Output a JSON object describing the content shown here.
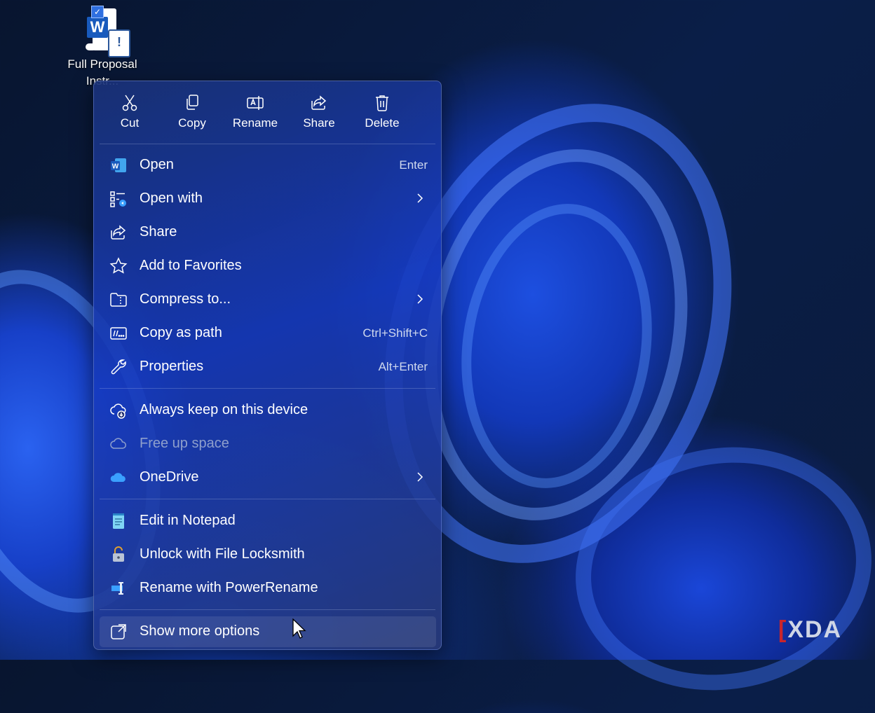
{
  "desktop": {
    "file_label_line1": "Full Proposal",
    "file_label_line2": "Instr...",
    "file_icon": "word-document-icon"
  },
  "toolbar": [
    {
      "label": "Cut",
      "icon": "scissors-icon"
    },
    {
      "label": "Copy",
      "icon": "copy-icon"
    },
    {
      "label": "Rename",
      "icon": "rename-icon"
    },
    {
      "label": "Share",
      "icon": "share-icon"
    },
    {
      "label": "Delete",
      "icon": "trash-icon"
    }
  ],
  "menu": {
    "items": [
      {
        "label": "Open",
        "shortcut": "Enter",
        "icon": "word-icon"
      },
      {
        "label": "Open with",
        "submenu": true,
        "icon": "open-with-icon"
      },
      {
        "label": "Share",
        "icon": "share-icon"
      },
      {
        "label": "Add to Favorites",
        "icon": "star-icon"
      },
      {
        "label": "Compress to...",
        "submenu": true,
        "icon": "zip-folder-icon"
      },
      {
        "label": "Copy as path",
        "shortcut": "Ctrl+Shift+C",
        "icon": "path-icon"
      },
      {
        "label": "Properties",
        "shortcut": "Alt+Enter",
        "icon": "wrench-icon"
      },
      {
        "label": "Always keep on this device",
        "icon": "cloud-download-icon"
      },
      {
        "label": "Free up space",
        "disabled": true,
        "icon": "cloud-icon"
      },
      {
        "label": "OneDrive",
        "submenu": true,
        "icon": "onedrive-icon"
      },
      {
        "label": "Edit in Notepad",
        "icon": "notepad-icon"
      },
      {
        "label": "Unlock with File Locksmith",
        "icon": "lock-icon"
      },
      {
        "label": "Rename with PowerRename",
        "icon": "powerrename-icon"
      },
      {
        "label": "Show more options",
        "icon": "external-icon"
      }
    ]
  },
  "watermark": {
    "text": "XDA"
  },
  "colors": {
    "accent": "#1c4ad8",
    "text": "#ffffff",
    "disabled_text": "#8e9fcc"
  }
}
